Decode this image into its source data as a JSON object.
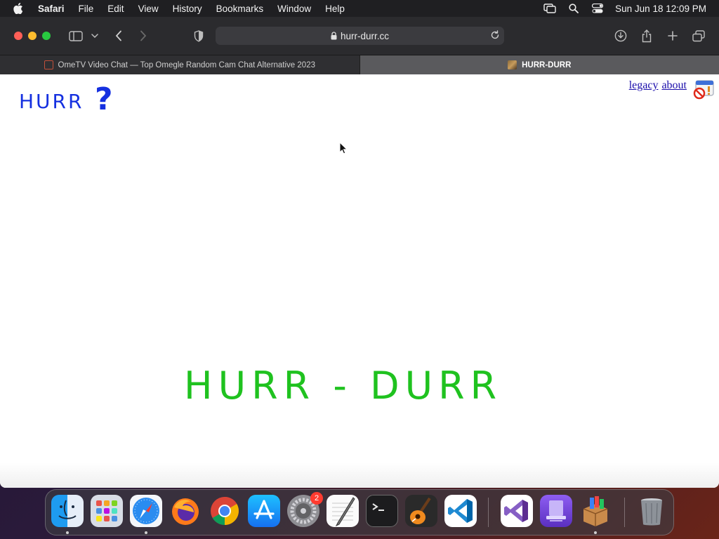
{
  "menubar": {
    "app_name": "Safari",
    "items": [
      "File",
      "Edit",
      "View",
      "History",
      "Bookmarks",
      "Window",
      "Help"
    ],
    "clock": "Sun Jun 18  12:09 PM"
  },
  "browser": {
    "address": "hurr-durr.cc",
    "tabs": [
      {
        "label": "OmeTV Video Chat — Top Omegle Random Cam Chat Alternative 2023",
        "active": false
      },
      {
        "label": "HURR-DURR",
        "active": true
      }
    ]
  },
  "page": {
    "logo_text": "HURR",
    "logo_mark": "?",
    "links": {
      "legacy": "legacy",
      "about": "about"
    },
    "headline": "HURR - DURR",
    "colors": {
      "logo": "#1530e0",
      "headline": "#1fc21f",
      "link": "#1a0dab"
    }
  },
  "dock": {
    "apps": [
      "Finder",
      "Launchpad",
      "Safari",
      "Firefox",
      "Chrome",
      "App Store",
      "System Settings",
      "TextEdit",
      "Terminal",
      "GarageBand",
      "Visual Studio Code",
      "Visual Studio",
      "Apple Configurator",
      "Installer",
      "Trash"
    ],
    "settings_badge": "2"
  }
}
